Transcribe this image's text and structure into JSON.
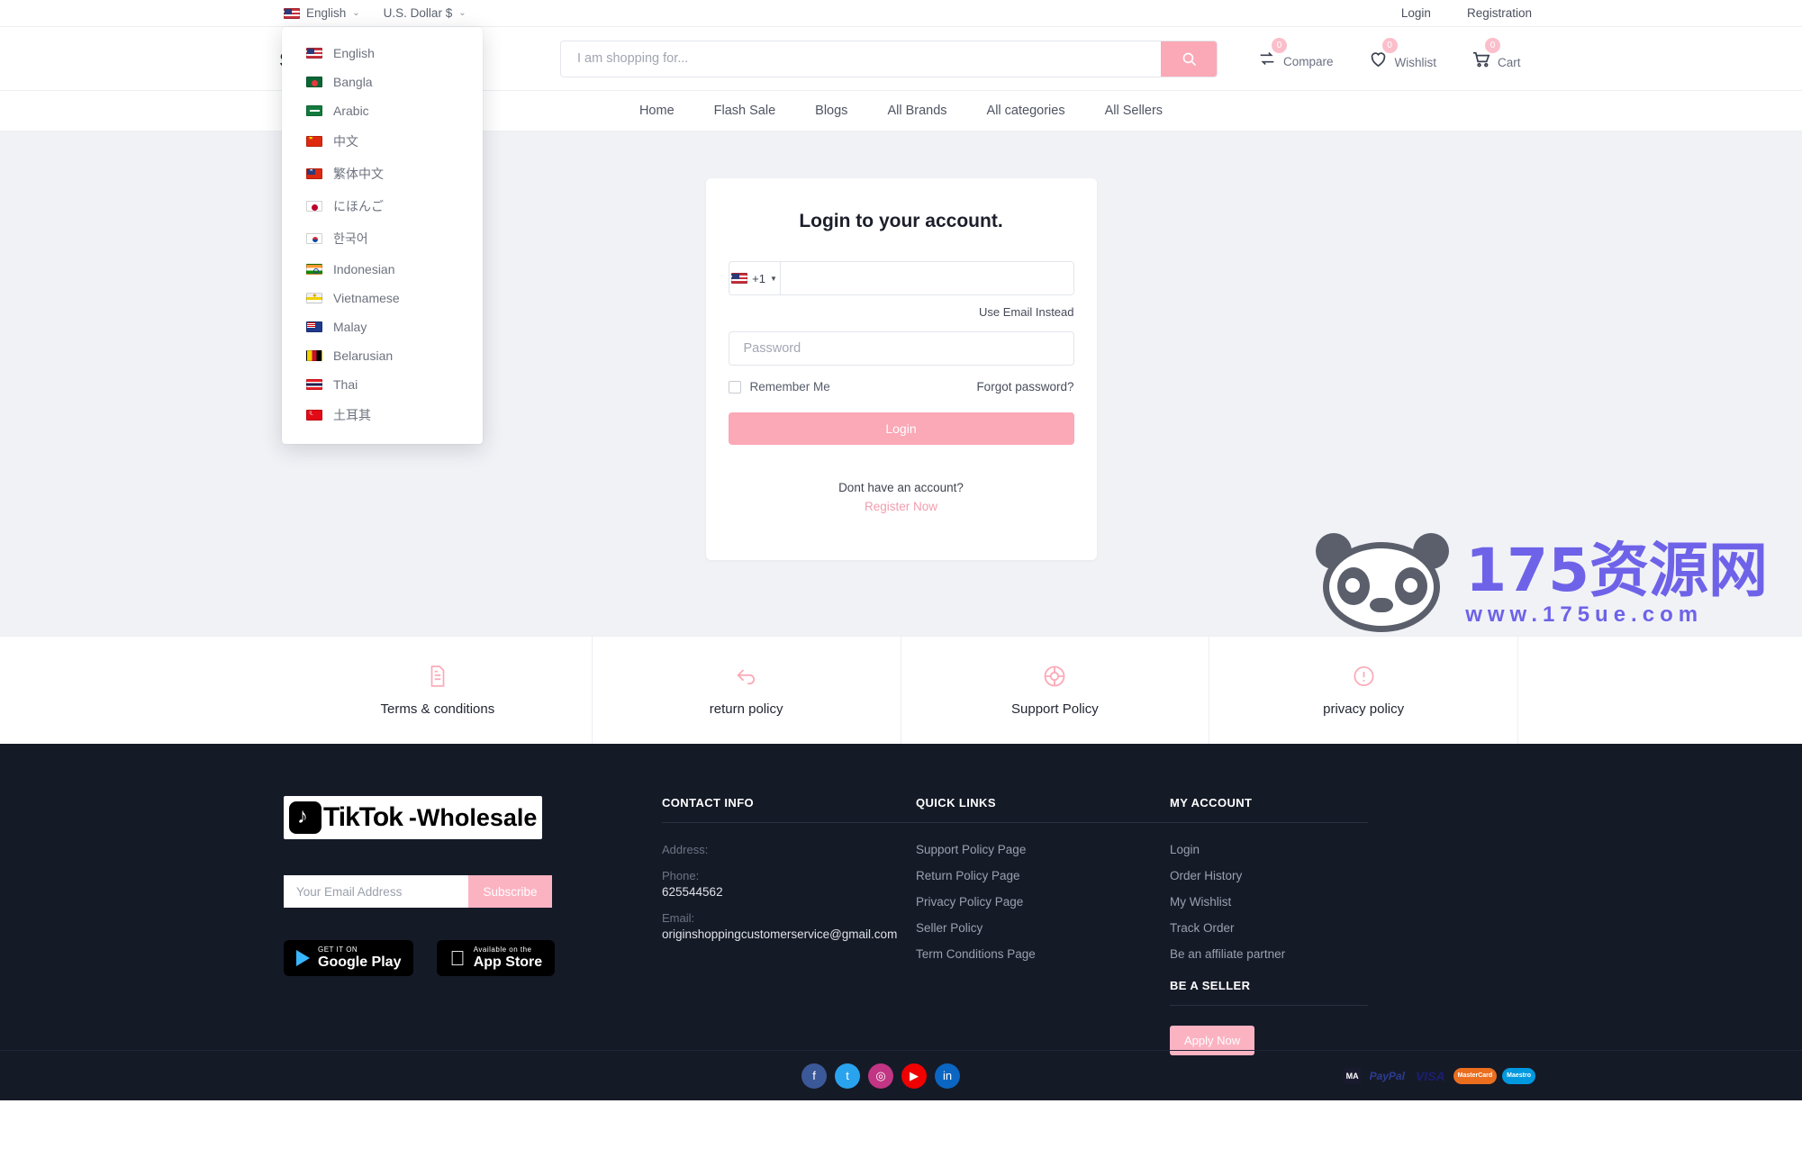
{
  "topbar": {
    "language": {
      "label": "English",
      "flag": "f-us"
    },
    "currency": {
      "label": "U.S. Dollar $"
    },
    "login": "Login",
    "registration": "Registration"
  },
  "language_dropdown": {
    "items": [
      {
        "label": "English",
        "flag": "f-us"
      },
      {
        "label": "Bangla",
        "flag": "f-bd"
      },
      {
        "label": "Arabic",
        "flag": "f-sa"
      },
      {
        "label": "中文",
        "flag": "f-cn"
      },
      {
        "label": "繁体中文",
        "flag": "f-tw"
      },
      {
        "label": "にほんご",
        "flag": "f-jp"
      },
      {
        "label": "한국어",
        "flag": "f-kr"
      },
      {
        "label": "Indonesian",
        "flag": "f-id"
      },
      {
        "label": "Vietnamese",
        "flag": "f-vn"
      },
      {
        "label": "Malay",
        "flag": "f-my"
      },
      {
        "label": "Belarusian",
        "flag": "f-by"
      },
      {
        "label": "Thai",
        "flag": "f-th"
      },
      {
        "label": "土耳其",
        "flag": "f-tr"
      }
    ]
  },
  "header": {
    "logo_text": "sale",
    "search_placeholder": "I am shopping for...",
    "search_value": "",
    "actions": [
      {
        "name": "compare",
        "label": "Compare",
        "count": "0"
      },
      {
        "name": "wishlist",
        "label": "Wishlist",
        "count": "0"
      },
      {
        "name": "cart",
        "label": "Cart",
        "count": "0"
      }
    ]
  },
  "nav": {
    "items": [
      "Home",
      "Flash Sale",
      "Blogs",
      "All Brands",
      "All categories",
      "All Sellers"
    ]
  },
  "login": {
    "title": "Login to your account.",
    "country_code": "+1",
    "phone_value": "",
    "use_email": "Use Email Instead",
    "password_placeholder": "Password",
    "remember_me": "Remember Me",
    "forgot": "Forgot password?",
    "login_button": "Login",
    "no_account": "Dont have an account?",
    "register_now": "Register Now"
  },
  "watermark": {
    "cn": "175资源网",
    "url": "www.175ue.com"
  },
  "policies": [
    {
      "label": "Terms & conditions",
      "icon": "document-icon"
    },
    {
      "label": "return policy",
      "icon": "return-arrow-icon"
    },
    {
      "label": "Support Policy",
      "icon": "lifebuoy-icon"
    },
    {
      "label": "privacy policy",
      "icon": "exclamation-circle-icon"
    }
  ],
  "footer": {
    "brand": {
      "word": "TikTok",
      "suffix": "-Wholesale"
    },
    "subscribe": {
      "placeholder": "Your Email Address",
      "value": "",
      "button": "Subscribe"
    },
    "stores": [
      {
        "small": "GET IT ON",
        "big": "Google Play",
        "icon": "google-play-icon"
      },
      {
        "small": "Available on the",
        "big": "App Store",
        "icon": "apple-icon"
      }
    ],
    "contact": {
      "heading": "CONTACT INFO",
      "address_label": "Address:",
      "address_value": "",
      "phone_label": "Phone:",
      "phone_value": "625544562",
      "email_label": "Email:",
      "email_value": "originshoppingcustomerservice@gmail.com"
    },
    "quick_links": {
      "heading": "QUICK LINKS",
      "items": [
        "Support Policy Page",
        "Return Policy Page",
        "Privacy Policy Page",
        "Seller Policy",
        "Term Conditions Page"
      ]
    },
    "my_account": {
      "heading": "MY ACCOUNT",
      "items": [
        "Login",
        "Order History",
        "My Wishlist",
        "Track Order",
        "Be an affiliate partner"
      ],
      "seller_heading": "BE A SELLER",
      "apply_button": "Apply Now"
    },
    "socials": [
      {
        "name": "facebook",
        "glyph": "f",
        "color": "#3b5998"
      },
      {
        "name": "twitter",
        "glyph": "t",
        "color": "#2aa3ef"
      },
      {
        "name": "instagram",
        "glyph": "◎",
        "color": "#c13584"
      },
      {
        "name": "youtube",
        "glyph": "▶",
        "color": "#f00000"
      },
      {
        "name": "linkedin",
        "glyph": "in",
        "color": "#0a66c2"
      }
    ],
    "payments": [
      {
        "name": "maestro-dark",
        "label": "MA",
        "color": "#1a1a2e"
      },
      {
        "name": "paypal",
        "label": "PayPal",
        "color": "#ffffff"
      },
      {
        "name": "visa",
        "label": "VISA",
        "color": "#ffffff"
      },
      {
        "name": "mastercard",
        "label": "MasterCard",
        "color": "#eb6e1e"
      },
      {
        "name": "maestro",
        "label": "Maestro",
        "color": "#0099df"
      }
    ]
  },
  "colors": {
    "accent": "#fba8b7",
    "footer_bg": "#151a27",
    "main_bg": "#f1f2f6"
  }
}
